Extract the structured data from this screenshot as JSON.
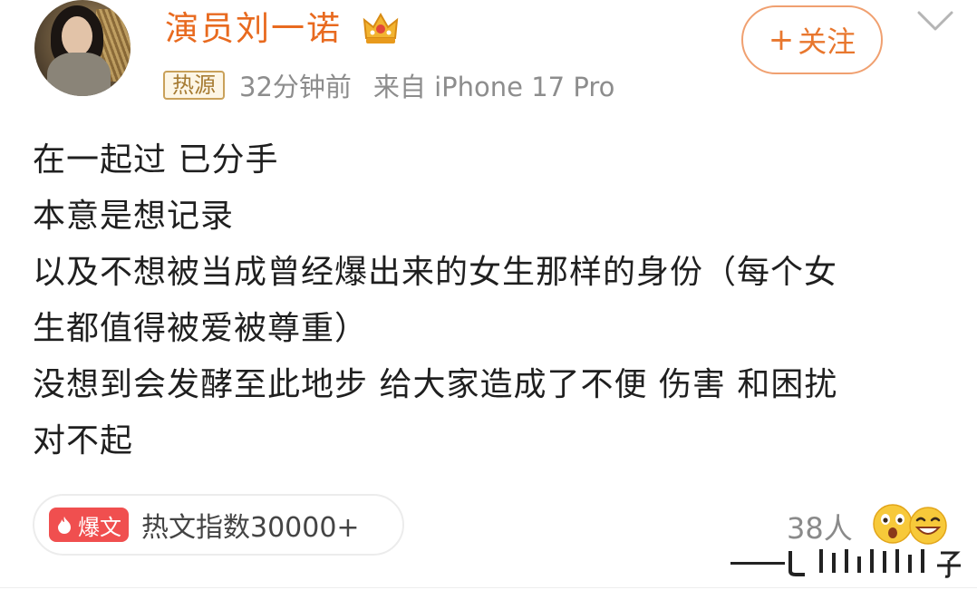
{
  "post": {
    "author": {
      "name": "演员刘一诺",
      "avatar_icon": "avatar-photo",
      "badge_icon": "crown-icon"
    },
    "follow_label": "关注",
    "meta": {
      "hot_badge": "热源",
      "time": "32分钟前",
      "source": "来自 iPhone 17 Pro"
    },
    "content_lines": [
      "在一起过 已分手",
      "本意是想记录",
      "以及不想被当成曾经爆出来的女生那样的身份（每个女",
      "生都值得被爱被尊重）",
      "没想到会发酵至此地步 给大家造成了不便 伤害 和困扰",
      "对不起"
    ],
    "hot_index": {
      "tag": "爆文",
      "text": "热文指数30000+"
    },
    "reactions": {
      "count": "38人",
      "icons": [
        "wow-emoji-icon",
        "grin-emoji-icon"
      ]
    }
  },
  "colors": {
    "username": "#e86a1f",
    "follow_border": "#f0a070",
    "hot_badge": "#a67b32",
    "boom_tag": "#f04f4f",
    "meta_text": "#8d8d8d"
  }
}
